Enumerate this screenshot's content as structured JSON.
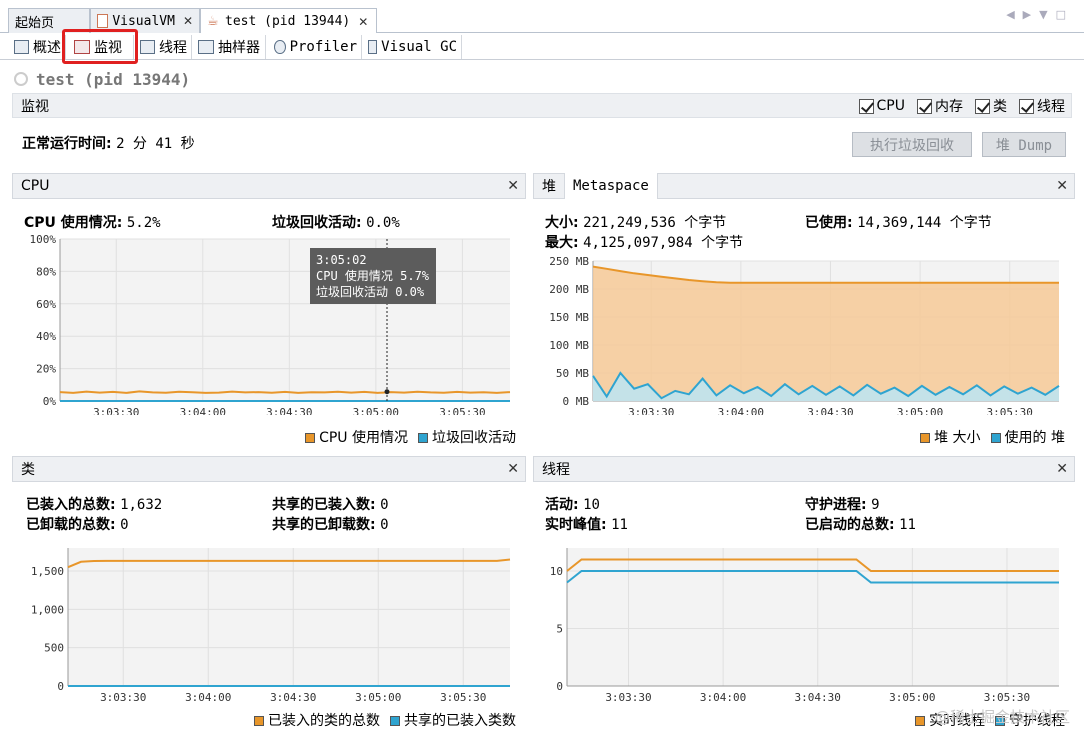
{
  "doc_tabs": [
    {
      "label": "起始页",
      "closable": false,
      "active": false
    },
    {
      "label": "VisualVM",
      "closable": true,
      "active": false
    },
    {
      "label": "test (pid 13944)",
      "closable": true,
      "active": true
    }
  ],
  "view_tabs": [
    {
      "label": "概述",
      "icon": "overview-icon"
    },
    {
      "label": "监视",
      "icon": "monitor-icon",
      "active": true
    },
    {
      "label": "线程",
      "icon": "threads-icon"
    },
    {
      "label": "抽样器",
      "icon": "sampler-icon"
    },
    {
      "label": "Profiler",
      "icon": "profiler-icon"
    },
    {
      "label": "Visual GC",
      "icon": "visual-gc-icon"
    }
  ],
  "process_title": "test (pid 13944)",
  "monitor": {
    "title": "监视",
    "checkboxes": [
      {
        "label": "CPU",
        "checked": true
      },
      {
        "label": "内存",
        "checked": true
      },
      {
        "label": "类",
        "checked": true
      },
      {
        "label": "线程",
        "checked": true
      }
    ],
    "uptime_label": "正常运行时间:",
    "uptime_value": "2 分 41 秒",
    "gc_button": "执行垃圾回收",
    "heap_dump_button": "堆 Dump"
  },
  "cpu_panel": {
    "title": "CPU",
    "usage_label": "CPU 使用情况:",
    "usage_value": "5.2%",
    "gc_label": "垃圾回收活动:",
    "gc_value": "0.0%",
    "tooltip": {
      "time": "3:05:02",
      "cpu": "CPU 使用情况 5.7%",
      "gc": "垃圾回收活动 0.0%"
    },
    "legend": [
      "CPU 使用情况",
      "垃圾回收活动"
    ]
  },
  "memory_panel": {
    "tabs": [
      "堆",
      "Metaspace"
    ],
    "size_label": "大小:",
    "size_value": "221,249,536 个字节",
    "used_label": "已使用:",
    "used_value": "14,369,144 个字节",
    "max_label": "最大:",
    "max_value": "4,125,097,984 个字节",
    "legend": [
      "堆 大小",
      "使用的 堆"
    ]
  },
  "classes_panel": {
    "title": "类",
    "loaded_total_label": "已装入的总数:",
    "loaded_total_value": "1,632",
    "shared_loaded_label": "共享的已装入数:",
    "shared_loaded_value": "0",
    "unloaded_total_label": "已卸载的总数:",
    "unloaded_total_value": "0",
    "shared_unloaded_label": "共享的已卸载数:",
    "shared_unloaded_value": "0",
    "legend": [
      "已装入的类的总数",
      "共享的已装入类数"
    ]
  },
  "threads_panel": {
    "title": "线程",
    "live_label": "活动:",
    "live_value": "10",
    "daemon_label": "守护进程:",
    "daemon_value": "9",
    "peak_label": "实时峰值:",
    "peak_value": "11",
    "started_label": "已启动的总数:",
    "started_value": "11",
    "legend": [
      "实时线程",
      "守护线程"
    ]
  },
  "colors": {
    "orange": "#e8962a",
    "blue": "#2fa4d0",
    "orange_fill": "#f6c996"
  },
  "watermark": "@稀土掘金技术社区",
  "chart_data": [
    {
      "type": "line",
      "title": "CPU",
      "x_ticks": [
        "3:03:30",
        "3:04:00",
        "3:04:30",
        "3:05:00",
        "3:05:30"
      ],
      "y_ticks": [
        "100%",
        "80%",
        "60%",
        "40%",
        "20%",
        "0%"
      ],
      "ylim": [
        0,
        100
      ],
      "series": [
        {
          "name": "CPU 使用情况",
          "color": "#e8962a",
          "values": [
            5.5,
            5.0,
            5.8,
            5.2,
            5.6,
            5.0,
            5.9,
            5.3,
            5.1,
            5.7,
            5.4,
            5.0,
            5.2,
            5.8,
            5.3,
            5.5,
            5.1,
            5.6,
            5.0,
            5.4,
            5.3,
            5.7,
            5.2,
            5.6,
            5.0,
            5.5,
            5.2,
            5.7,
            5.3,
            5.1,
            5.6,
            5.2,
            5.4,
            5.0,
            5.5
          ]
        },
        {
          "name": "垃圾回收活动",
          "color": "#2fa4d0",
          "values": [
            0,
            0,
            0,
            0,
            0,
            0,
            0,
            0,
            0,
            0,
            0,
            0,
            0,
            0,
            0,
            0,
            0,
            0,
            0,
            0,
            0,
            0,
            0,
            0,
            0,
            0,
            0,
            0,
            0,
            0,
            0,
            0,
            0,
            0,
            0
          ]
        }
      ]
    },
    {
      "type": "area",
      "title": "堆",
      "x_ticks": [
        "3:03:30",
        "3:04:00",
        "3:04:30",
        "3:05:00",
        "3:05:30"
      ],
      "y_ticks": [
        "250 MB",
        "200 MB",
        "150 MB",
        "100 MB",
        "50 MB",
        "0 MB"
      ],
      "ylim": [
        0,
        250
      ],
      "series": [
        {
          "name": "堆 大小",
          "color": "#e8962a",
          "values": [
            240,
            236,
            232,
            228,
            225,
            222,
            219,
            216,
            214,
            212,
            211,
            211,
            211,
            211,
            211,
            211,
            211,
            211,
            211,
            211,
            211,
            211,
            211,
            211,
            211,
            211,
            211,
            211,
            211,
            211,
            211,
            211,
            211,
            211,
            211
          ]
        },
        {
          "name": "使用的 堆",
          "color": "#2fa4d0",
          "values": [
            45,
            8,
            50,
            22,
            30,
            5,
            18,
            12,
            40,
            10,
            28,
            14,
            25,
            9,
            30,
            12,
            27,
            11,
            26,
            10,
            29,
            13,
            24,
            9,
            27,
            11,
            25,
            12,
            28,
            10,
            26,
            13,
            24,
            11,
            27
          ]
        }
      ]
    },
    {
      "type": "line",
      "title": "类",
      "x_ticks": [
        "3:03:30",
        "3:04:00",
        "3:04:30",
        "3:05:00",
        "3:05:30"
      ],
      "y_ticks": [
        "1,500",
        "1,000",
        "500",
        "0"
      ],
      "ylim": [
        0,
        1800
      ],
      "series": [
        {
          "name": "已装入的类的总数",
          "color": "#e8962a",
          "values": [
            1550,
            1620,
            1630,
            1632,
            1632,
            1632,
            1632,
            1632,
            1632,
            1632,
            1632,
            1632,
            1632,
            1632,
            1632,
            1632,
            1632,
            1632,
            1632,
            1632,
            1632,
            1632,
            1632,
            1632,
            1632,
            1632,
            1632,
            1632,
            1632,
            1632,
            1632,
            1632,
            1632,
            1632,
            1650
          ]
        },
        {
          "name": "共享的已装入类数",
          "color": "#2fa4d0",
          "values": [
            0,
            0,
            0,
            0,
            0,
            0,
            0,
            0,
            0,
            0,
            0,
            0,
            0,
            0,
            0,
            0,
            0,
            0,
            0,
            0,
            0,
            0,
            0,
            0,
            0,
            0,
            0,
            0,
            0,
            0,
            0,
            0,
            0,
            0,
            0
          ]
        }
      ]
    },
    {
      "type": "line",
      "title": "线程",
      "x_ticks": [
        "3:03:30",
        "3:04:00",
        "3:04:30",
        "3:05:00",
        "3:05:30"
      ],
      "y_ticks": [
        "10",
        "5",
        "0"
      ],
      "ylim": [
        0,
        12
      ],
      "series": [
        {
          "name": "实时线程",
          "color": "#e8962a",
          "values": [
            10,
            11,
            11,
            11,
            11,
            11,
            11,
            11,
            11,
            11,
            11,
            11,
            11,
            11,
            11,
            11,
            11,
            11,
            11,
            11,
            11,
            10,
            10,
            10,
            10,
            10,
            10,
            10,
            10,
            10,
            10,
            10,
            10,
            10,
            10
          ]
        },
        {
          "name": "守护线程",
          "color": "#2fa4d0",
          "values": [
            9,
            10,
            10,
            10,
            10,
            10,
            10,
            10,
            10,
            10,
            10,
            10,
            10,
            10,
            10,
            10,
            10,
            10,
            10,
            10,
            10,
            9,
            9,
            9,
            9,
            9,
            9,
            9,
            9,
            9,
            9,
            9,
            9,
            9,
            9
          ]
        }
      ]
    }
  ]
}
